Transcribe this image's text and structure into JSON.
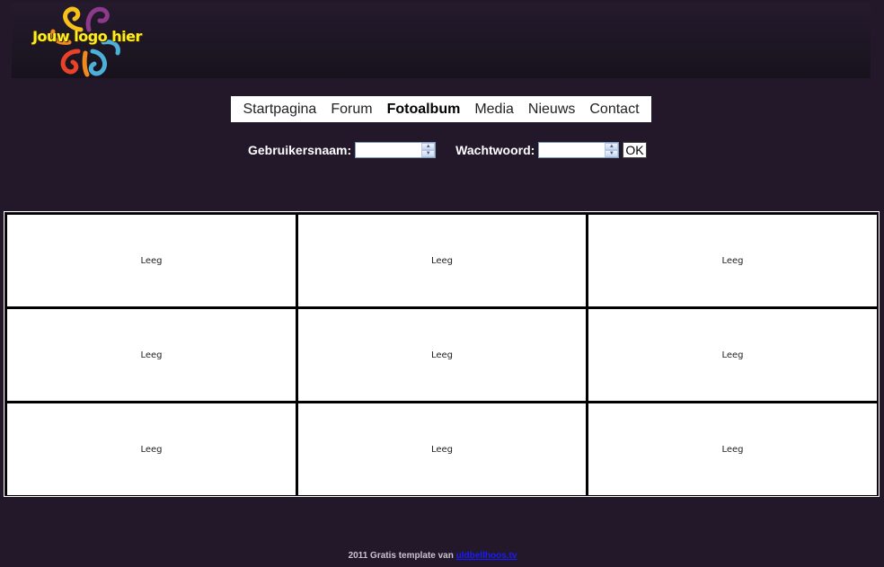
{
  "logo": {
    "text": "Jouw logo hier",
    "icon": "swirl-flower-logo",
    "colors": [
      "#f6c21a",
      "#8e3a8c",
      "#e8432a",
      "#4db0d8",
      "#f08a1c"
    ]
  },
  "nav": {
    "items": [
      {
        "label": "Startpagina",
        "active": false
      },
      {
        "label": "Forum",
        "active": false
      },
      {
        "label": "Fotoalbum",
        "active": true
      },
      {
        "label": "Media",
        "active": false
      },
      {
        "label": "Nieuws",
        "active": false
      },
      {
        "label": "Contact",
        "active": false
      }
    ]
  },
  "login": {
    "username_label": "Gebruikersnaam:",
    "username_value": "",
    "password_label": "Wachtwoord:",
    "password_value": "",
    "submit_label": "OK"
  },
  "gallery": {
    "cells": [
      "Leeg",
      "Leeg",
      "Leeg",
      "Leeg",
      "Leeg",
      "Leeg",
      "Leeg",
      "Leeg",
      "Leeg"
    ]
  },
  "footer": {
    "text": "2011 Gratis template van ",
    "link_text": "uldbellhoos.tv"
  },
  "colors": {
    "background": "#22182a",
    "nav_background": "#ffffff",
    "footer_link": "#1a1aff"
  }
}
